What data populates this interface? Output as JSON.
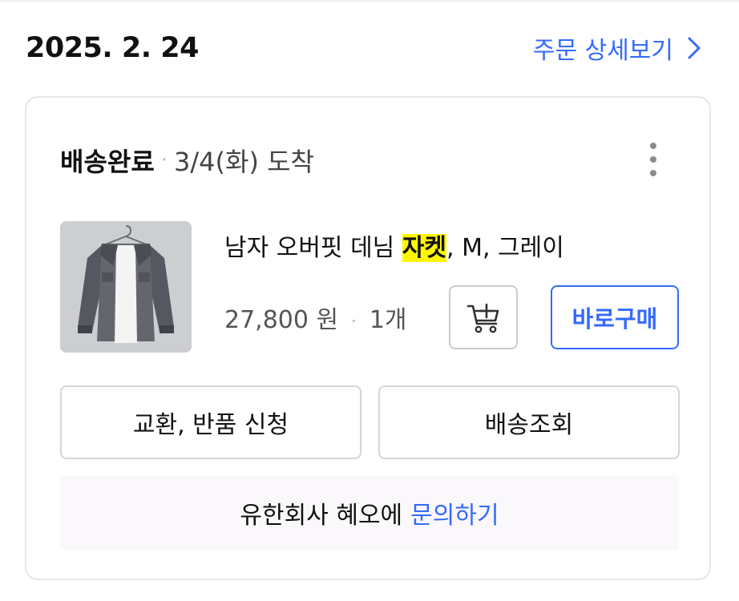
{
  "order": {
    "date": "2025. 2. 24",
    "detail_link_label": "주문 상세보기"
  },
  "shipment": {
    "status": "배송완료",
    "separator": "·",
    "arrival": "3/4(화) 도착"
  },
  "product": {
    "name_before": "남자 오버핏 데님 ",
    "name_highlight": "자켓",
    "name_after": ", M, 그레이",
    "price": "27,800 원",
    "separator": "·",
    "quantity": "1개",
    "thumbnail_icon": "gray-denim-jacket-image"
  },
  "buttons": {
    "buy_now": "바로구매",
    "exchange_return": "교환, 반품 신청",
    "tracking": "배송조회"
  },
  "inquiry": {
    "seller_text": "유한회사 혜오에",
    "link_label": "문의하기"
  },
  "colors": {
    "accent": "#346aff",
    "highlight": "#fff700",
    "inquiry_bg": "#fbf8fc"
  }
}
